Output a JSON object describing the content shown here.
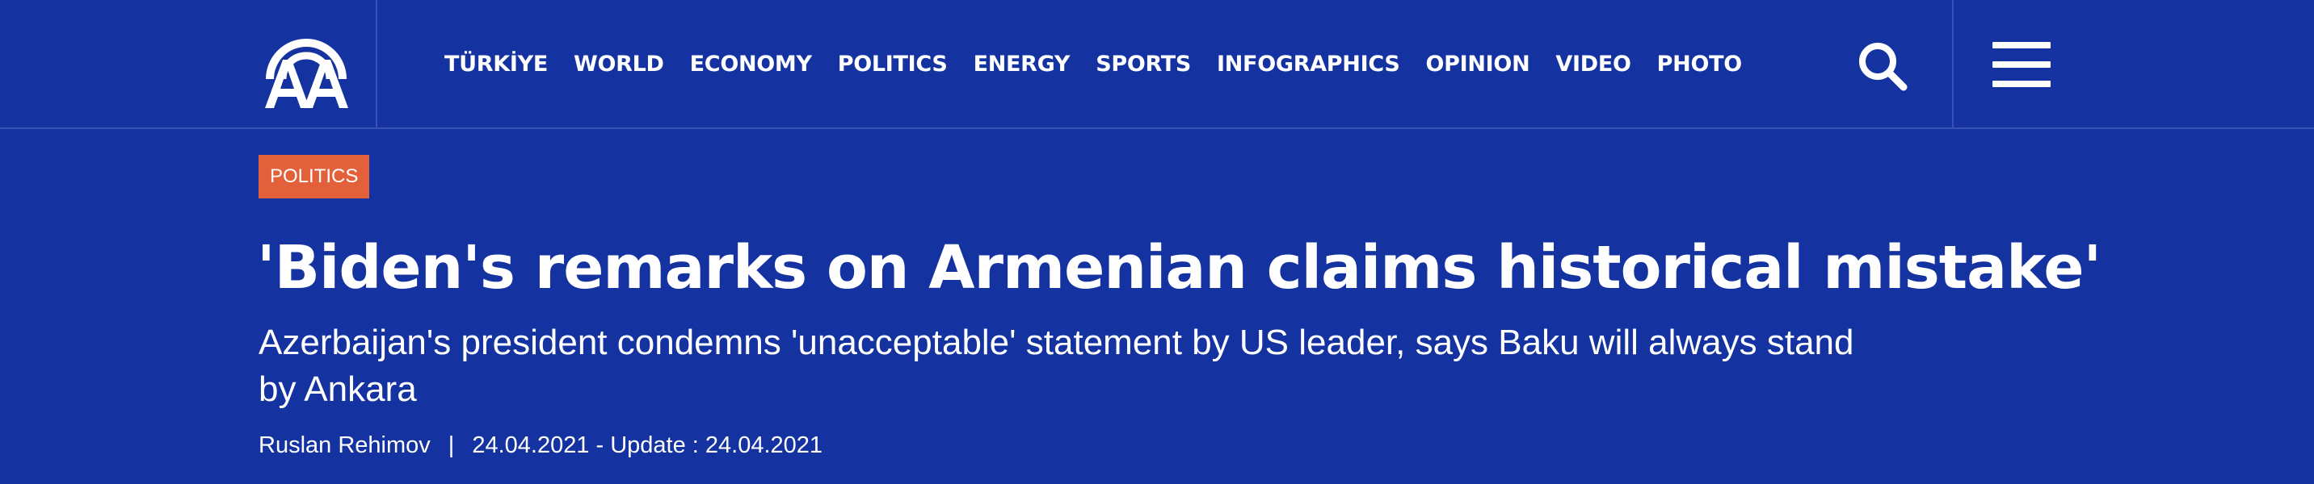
{
  "logo": {
    "text": "AA"
  },
  "nav": {
    "items": [
      "TÜRKİYE",
      "WORLD",
      "ECONOMY",
      "POLITICS",
      "ENERGY",
      "SPORTS",
      "INFOGRAPHICS",
      "OPINION",
      "VIDEO",
      "PHOTO"
    ]
  },
  "header": {
    "search_icon": "search-icon",
    "menu_icon": "hamburger-menu-icon"
  },
  "article": {
    "category": "POLITICS",
    "title": "'Biden's remarks on Armenian claims historical mistake'",
    "subtitle": "Azerbaijan's president condemns 'unacceptable' statement by US leader, says Baku will always stand by Ankara",
    "author": "Ruslan Rehimov",
    "separator": "|",
    "date_line": "24.04.2021 - Update : 24.04.2021"
  },
  "colors": {
    "background": "#1433a0",
    "divider": "#3752b4",
    "badge": "#e3613a",
    "text": "#ffffff"
  }
}
